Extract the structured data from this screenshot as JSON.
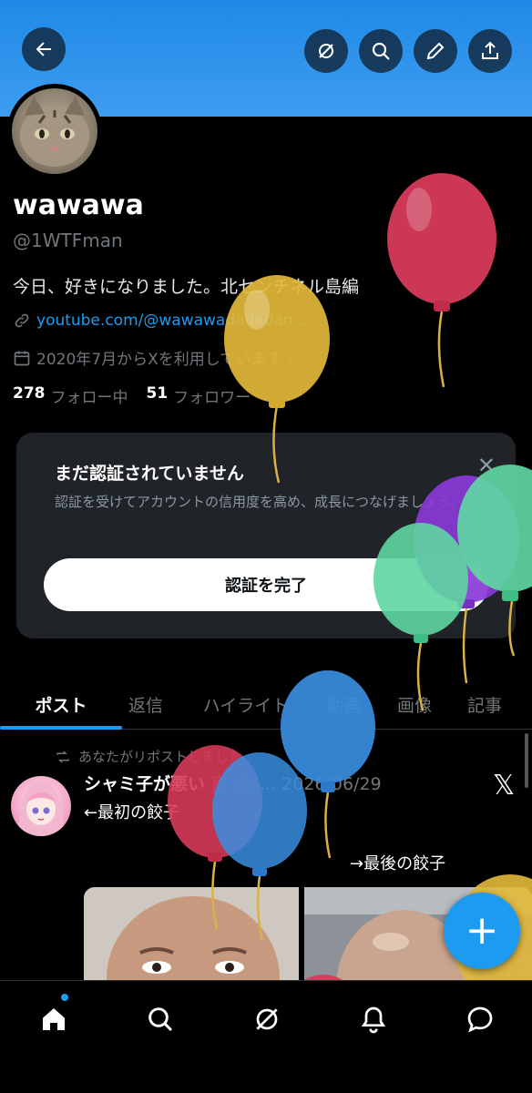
{
  "header": {
    "back_icon": "back-arrow-icon",
    "actions": [
      "grok-icon",
      "search-icon",
      "edit-icon",
      "share-icon"
    ]
  },
  "profile": {
    "name": "wawawa",
    "handle": "@1WTFman",
    "bio": "今日、好きになりました。北センチネル島編",
    "link": "youtube.com/@wawawadadadan...",
    "joined": "2020年7月からXを利用しています",
    "following_count": "278",
    "following_label": "フォロー中",
    "followers_count": "51",
    "followers_label": "フォロワー"
  },
  "verify_card": {
    "title": "まだ認証されていません",
    "text": "認証を受けてアカウントの信用度を高め、成長につなげましょう。",
    "button": "認証を完了",
    "close": "✕"
  },
  "tabs": [
    "ポスト",
    "返信",
    "ハイライト",
    "動画",
    "画像",
    "記事"
  ],
  "active_tab": "ポスト",
  "post": {
    "repost_note": "あなたがリポストしました",
    "author": "シャミ子が悪い",
    "author_rest": "良 @s...",
    "date": "2026/06/29",
    "text1": "←最初の餃子",
    "text2": "→最後の餃子"
  },
  "fab_label": "+",
  "nav": [
    "home-icon",
    "search-icon",
    "grok-icon",
    "notifications-icon",
    "messages-icon"
  ],
  "colors": {
    "accent": "#1d9bf0",
    "banner": "#2a8fe8",
    "balloon_red": "#d63a58",
    "balloon_yellow": "#e3b93a",
    "balloon_green": "#5ed6a2",
    "balloon_purple": "#8a3bd8",
    "balloon_blue": "#3a8ee0"
  }
}
